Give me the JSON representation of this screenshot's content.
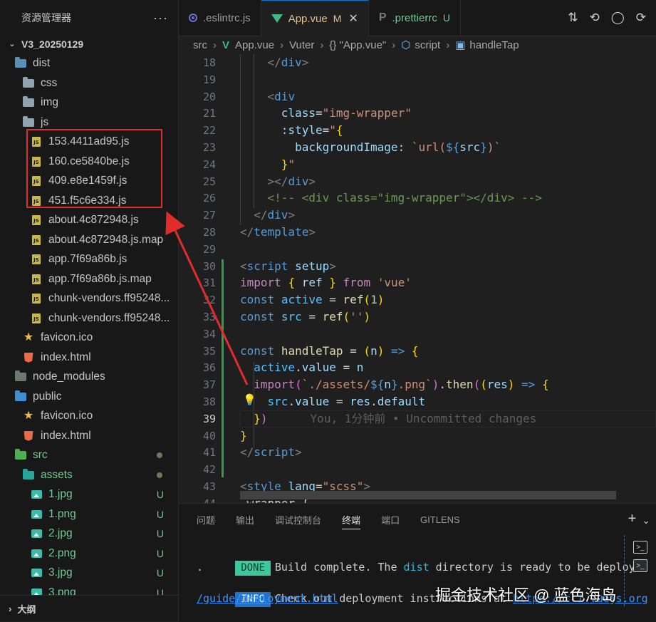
{
  "explorer": {
    "title": "资源管理器",
    "more": "···",
    "root": "V3_20250129",
    "outline": "大纲",
    "items": [
      {
        "label": "dist",
        "kind": "folder-dist",
        "depth": 1,
        "open": true
      },
      {
        "label": "css",
        "kind": "folder",
        "depth": 2
      },
      {
        "label": "img",
        "kind": "folder",
        "depth": 2
      },
      {
        "label": "js",
        "kind": "folder-open",
        "depth": 2,
        "open": true
      },
      {
        "label": "153.4411ad95.js",
        "kind": "js",
        "depth": 3
      },
      {
        "label": "160.ce5840be.js",
        "kind": "js",
        "depth": 3
      },
      {
        "label": "409.e8e1459f.js",
        "kind": "js",
        "depth": 3
      },
      {
        "label": "451.f5c6e334.js",
        "kind": "js",
        "depth": 3
      },
      {
        "label": "about.4c872948.js",
        "kind": "js",
        "depth": 3
      },
      {
        "label": "about.4c872948.js.map",
        "kind": "js",
        "depth": 3
      },
      {
        "label": "app.7f69a86b.js",
        "kind": "js",
        "depth": 3
      },
      {
        "label": "app.7f69a86b.js.map",
        "kind": "js",
        "depth": 3
      },
      {
        "label": "chunk-vendors.ff95248...",
        "kind": "js",
        "depth": 3
      },
      {
        "label": "chunk-vendors.ff95248...",
        "kind": "js",
        "depth": 3
      },
      {
        "label": "favicon.ico",
        "kind": "star",
        "depth": 2
      },
      {
        "label": "index.html",
        "kind": "html",
        "depth": 2
      },
      {
        "label": "node_modules",
        "kind": "folder-node",
        "depth": 1
      },
      {
        "label": "public",
        "kind": "folder-public",
        "depth": 1,
        "open": true
      },
      {
        "label": "favicon.ico",
        "kind": "star",
        "depth": 2
      },
      {
        "label": "index.html",
        "kind": "html",
        "depth": 2
      },
      {
        "label": "src",
        "kind": "folder-src",
        "depth": 1,
        "open": true,
        "status": "dot",
        "green": true
      },
      {
        "label": "assets",
        "kind": "folder-assets",
        "depth": 2,
        "open": true,
        "status": "dot",
        "green": true
      },
      {
        "label": "1.jpg",
        "kind": "img",
        "depth": 3,
        "status": "U",
        "green": true
      },
      {
        "label": "1.png",
        "kind": "img",
        "depth": 3,
        "status": "U",
        "green": true
      },
      {
        "label": "2.jpg",
        "kind": "img",
        "depth": 3,
        "status": "U",
        "green": true
      },
      {
        "label": "2.png",
        "kind": "img",
        "depth": 3,
        "status": "U",
        "green": true
      },
      {
        "label": "3.jpg",
        "kind": "img",
        "depth": 3,
        "status": "U",
        "green": true
      },
      {
        "label": "3.png",
        "kind": "img",
        "depth": 3,
        "status": "U",
        "green": true
      }
    ]
  },
  "tabs": [
    {
      "label": ".eslintrc.js",
      "icon": "eslint-icon"
    },
    {
      "label": "App.vue",
      "icon": "vue-icon",
      "mark": "M",
      "active": true
    },
    {
      "label": ".prettierrc",
      "icon": "prettier-icon",
      "mark": "U"
    }
  ],
  "tab_actions": [
    "⇅",
    "⟲",
    "◯",
    "⟳"
  ],
  "breadcrumb": [
    "src",
    "App.vue",
    "Vuter",
    "{} \"App.vue\"",
    "script",
    "handleTap"
  ],
  "editor": {
    "current_line": 39,
    "blame": "You, 1分钟前 • Uncommitted changes",
    "lines": [
      {
        "n": 18,
        "t": [
          [
            "    ",
            "tk-txt"
          ],
          [
            "</",
            "tk-p"
          ],
          [
            "div",
            "tk-tag"
          ],
          [
            ">",
            "tk-p"
          ]
        ]
      },
      {
        "n": 19,
        "t": []
      },
      {
        "n": 20,
        "t": [
          [
            "    ",
            "tk-txt"
          ],
          [
            "<",
            "tk-p"
          ],
          [
            "div",
            "tk-tag"
          ]
        ]
      },
      {
        "n": 21,
        "t": [
          [
            "      ",
            "tk-txt"
          ],
          [
            "class",
            "tk-attr"
          ],
          [
            "=",
            "tk-eq"
          ],
          [
            "\"img-wrapper\"",
            "tk-str"
          ]
        ]
      },
      {
        "n": 22,
        "t": [
          [
            "      ",
            "tk-txt"
          ],
          [
            ":style",
            "tk-attr"
          ],
          [
            "=",
            "tk-eq"
          ],
          [
            "\"",
            "tk-str"
          ],
          [
            "{",
            "tk-y"
          ]
        ]
      },
      {
        "n": 23,
        "t": [
          [
            "        ",
            "tk-txt"
          ],
          [
            "backgroundImage",
            "tk-var"
          ],
          [
            ": ",
            "tk-txt"
          ],
          [
            "`url(",
            "tk-str"
          ],
          [
            "${",
            "tk-kw"
          ],
          [
            "src",
            "tk-var"
          ],
          [
            "}",
            "tk-kw"
          ],
          [
            ")`",
            "tk-str"
          ]
        ]
      },
      {
        "n": 24,
        "t": [
          [
            "      ",
            "tk-txt"
          ],
          [
            "}",
            "tk-y"
          ],
          [
            "\"",
            "tk-str"
          ]
        ]
      },
      {
        "n": 25,
        "t": [
          [
            "    ",
            "tk-txt"
          ],
          [
            ">",
            "tk-p"
          ],
          [
            "</",
            "tk-p"
          ],
          [
            "div",
            "tk-tag"
          ],
          [
            ">",
            "tk-p"
          ]
        ]
      },
      {
        "n": 26,
        "t": [
          [
            "    ",
            "tk-txt"
          ],
          [
            "<!-- <div class=\"img-wrapper\"></div> -->",
            "tk-c"
          ]
        ]
      },
      {
        "n": 27,
        "t": [
          [
            "  ",
            "tk-txt"
          ],
          [
            "</",
            "tk-p"
          ],
          [
            "div",
            "tk-tag"
          ],
          [
            ">",
            "tk-p"
          ]
        ]
      },
      {
        "n": 28,
        "t": [
          [
            "</",
            "tk-p"
          ],
          [
            "template",
            "tk-tag"
          ],
          [
            ">",
            "tk-p"
          ]
        ]
      },
      {
        "n": 29,
        "t": []
      },
      {
        "n": 30,
        "t": [
          [
            "<",
            "tk-p"
          ],
          [
            "script",
            "tk-tag"
          ],
          [
            " ",
            "tk-txt"
          ],
          [
            "setup",
            "tk-attr"
          ],
          [
            ">",
            "tk-p"
          ]
        ]
      },
      {
        "n": 31,
        "t": [
          [
            "import",
            "tk-kw2"
          ],
          [
            " ",
            "tk-txt"
          ],
          [
            "{",
            "tk-y"
          ],
          [
            " ",
            "tk-txt"
          ],
          [
            "ref",
            "tk-var"
          ],
          [
            " ",
            "tk-txt"
          ],
          [
            "}",
            "tk-y"
          ],
          [
            " ",
            "tk-txt"
          ],
          [
            "from",
            "tk-kw2"
          ],
          [
            " ",
            "tk-txt"
          ],
          [
            "'vue'",
            "tk-str"
          ]
        ]
      },
      {
        "n": 32,
        "t": [
          [
            "const",
            "tk-kw"
          ],
          [
            " ",
            "tk-txt"
          ],
          [
            "active",
            "tk-const"
          ],
          [
            " = ",
            "tk-txt"
          ],
          [
            "ref",
            "tk-fn"
          ],
          [
            "(",
            "tk-y"
          ],
          [
            "1",
            "tk-num"
          ],
          [
            ")",
            "tk-y"
          ]
        ]
      },
      {
        "n": 33,
        "t": [
          [
            "const",
            "tk-kw"
          ],
          [
            " ",
            "tk-txt"
          ],
          [
            "src",
            "tk-const"
          ],
          [
            " = ",
            "tk-txt"
          ],
          [
            "ref",
            "tk-fn"
          ],
          [
            "(",
            "tk-y"
          ],
          [
            "''",
            "tk-str"
          ],
          [
            ")",
            "tk-y"
          ]
        ]
      },
      {
        "n": 34,
        "t": []
      },
      {
        "n": 35,
        "t": [
          [
            "const",
            "tk-kw"
          ],
          [
            " ",
            "tk-txt"
          ],
          [
            "handleTap",
            "tk-fn"
          ],
          [
            " = ",
            "tk-txt"
          ],
          [
            "(",
            "tk-y"
          ],
          [
            "n",
            "tk-var"
          ],
          [
            ")",
            "tk-y"
          ],
          [
            " ",
            "tk-txt"
          ],
          [
            "=>",
            "tk-kw"
          ],
          [
            " ",
            "tk-txt"
          ],
          [
            "{",
            "tk-y"
          ]
        ]
      },
      {
        "n": 36,
        "t": [
          [
            "  ",
            "tk-txt"
          ],
          [
            "active",
            "tk-const"
          ],
          [
            ".",
            "tk-txt"
          ],
          [
            "value",
            "tk-var"
          ],
          [
            " = ",
            "tk-txt"
          ],
          [
            "n",
            "tk-var"
          ]
        ]
      },
      {
        "n": 37,
        "t": [
          [
            "  ",
            "tk-txt"
          ],
          [
            "import",
            "tk-kw2"
          ],
          [
            "(",
            "tk-m"
          ],
          [
            "`./assets/",
            "tk-str"
          ],
          [
            "${",
            "tk-kw"
          ],
          [
            "n",
            "tk-var"
          ],
          [
            "}",
            "tk-kw"
          ],
          [
            ".png`",
            "tk-str"
          ],
          [
            ")",
            "tk-m"
          ],
          [
            ".",
            "tk-txt"
          ],
          [
            "then",
            "tk-fn"
          ],
          [
            "(",
            "tk-m"
          ],
          [
            "(",
            "tk-y"
          ],
          [
            "res",
            "tk-var"
          ],
          [
            ")",
            "tk-y"
          ],
          [
            " ",
            "tk-txt"
          ],
          [
            "=>",
            "tk-kw"
          ],
          [
            " ",
            "tk-txt"
          ],
          [
            "{",
            "tk-y"
          ]
        ]
      },
      {
        "n": 38,
        "t": [
          [
            "    ",
            "tk-txt"
          ],
          [
            "src",
            "tk-const"
          ],
          [
            ".",
            "tk-txt"
          ],
          [
            "value",
            "tk-var"
          ],
          [
            " = ",
            "tk-txt"
          ],
          [
            "res",
            "tk-var"
          ],
          [
            ".",
            "tk-txt"
          ],
          [
            "default",
            "tk-var"
          ]
        ]
      },
      {
        "n": 39,
        "t": [
          [
            "  ",
            "tk-txt"
          ],
          [
            "}",
            "tk-y"
          ],
          [
            ")",
            "tk-m"
          ]
        ]
      },
      {
        "n": 40,
        "t": [
          [
            "}",
            "tk-y"
          ]
        ]
      },
      {
        "n": 41,
        "t": [
          [
            "</",
            "tk-p"
          ],
          [
            "script",
            "tk-tag"
          ],
          [
            ">",
            "tk-p"
          ]
        ]
      },
      {
        "n": 42,
        "t": []
      },
      {
        "n": 43,
        "t": [
          [
            "<",
            "tk-p"
          ],
          [
            "style",
            "tk-tag"
          ],
          [
            " ",
            "tk-txt"
          ],
          [
            "lang",
            "tk-attr"
          ],
          [
            "=",
            "tk-eq"
          ],
          [
            "\"scss\"",
            "tk-str"
          ],
          [
            ">",
            "tk-p"
          ]
        ]
      },
      {
        "n": 44,
        "t": [
          [
            ".wrapper {",
            "tk-txt"
          ]
        ]
      }
    ]
  },
  "panel": {
    "tabs": [
      "问题",
      "输出",
      "调试控制台",
      "终端",
      "端口",
      "GITLENS"
    ],
    "active_tab": "终端",
    "add": "+",
    "dropdown": "⌄",
    "done_badge": "DONE",
    "done_prefix": "Build complete. The ",
    "done_dir": "dist",
    "done_suffix": " directory is ready to be deployed",
    "done_cont": ".",
    "info_badge": "INFO",
    "info_prefix": "Check out deployment instructions at ",
    "info_link_a": "https://cli.vuejs.org",
    "info_link_b": "/guide/deployment.html"
  },
  "watermark": "掘金技术社区 @ 蓝色海岛",
  "colors": {
    "accent": "#0078d4",
    "git_added": "#73c991",
    "annotation": "#e22b2b"
  }
}
